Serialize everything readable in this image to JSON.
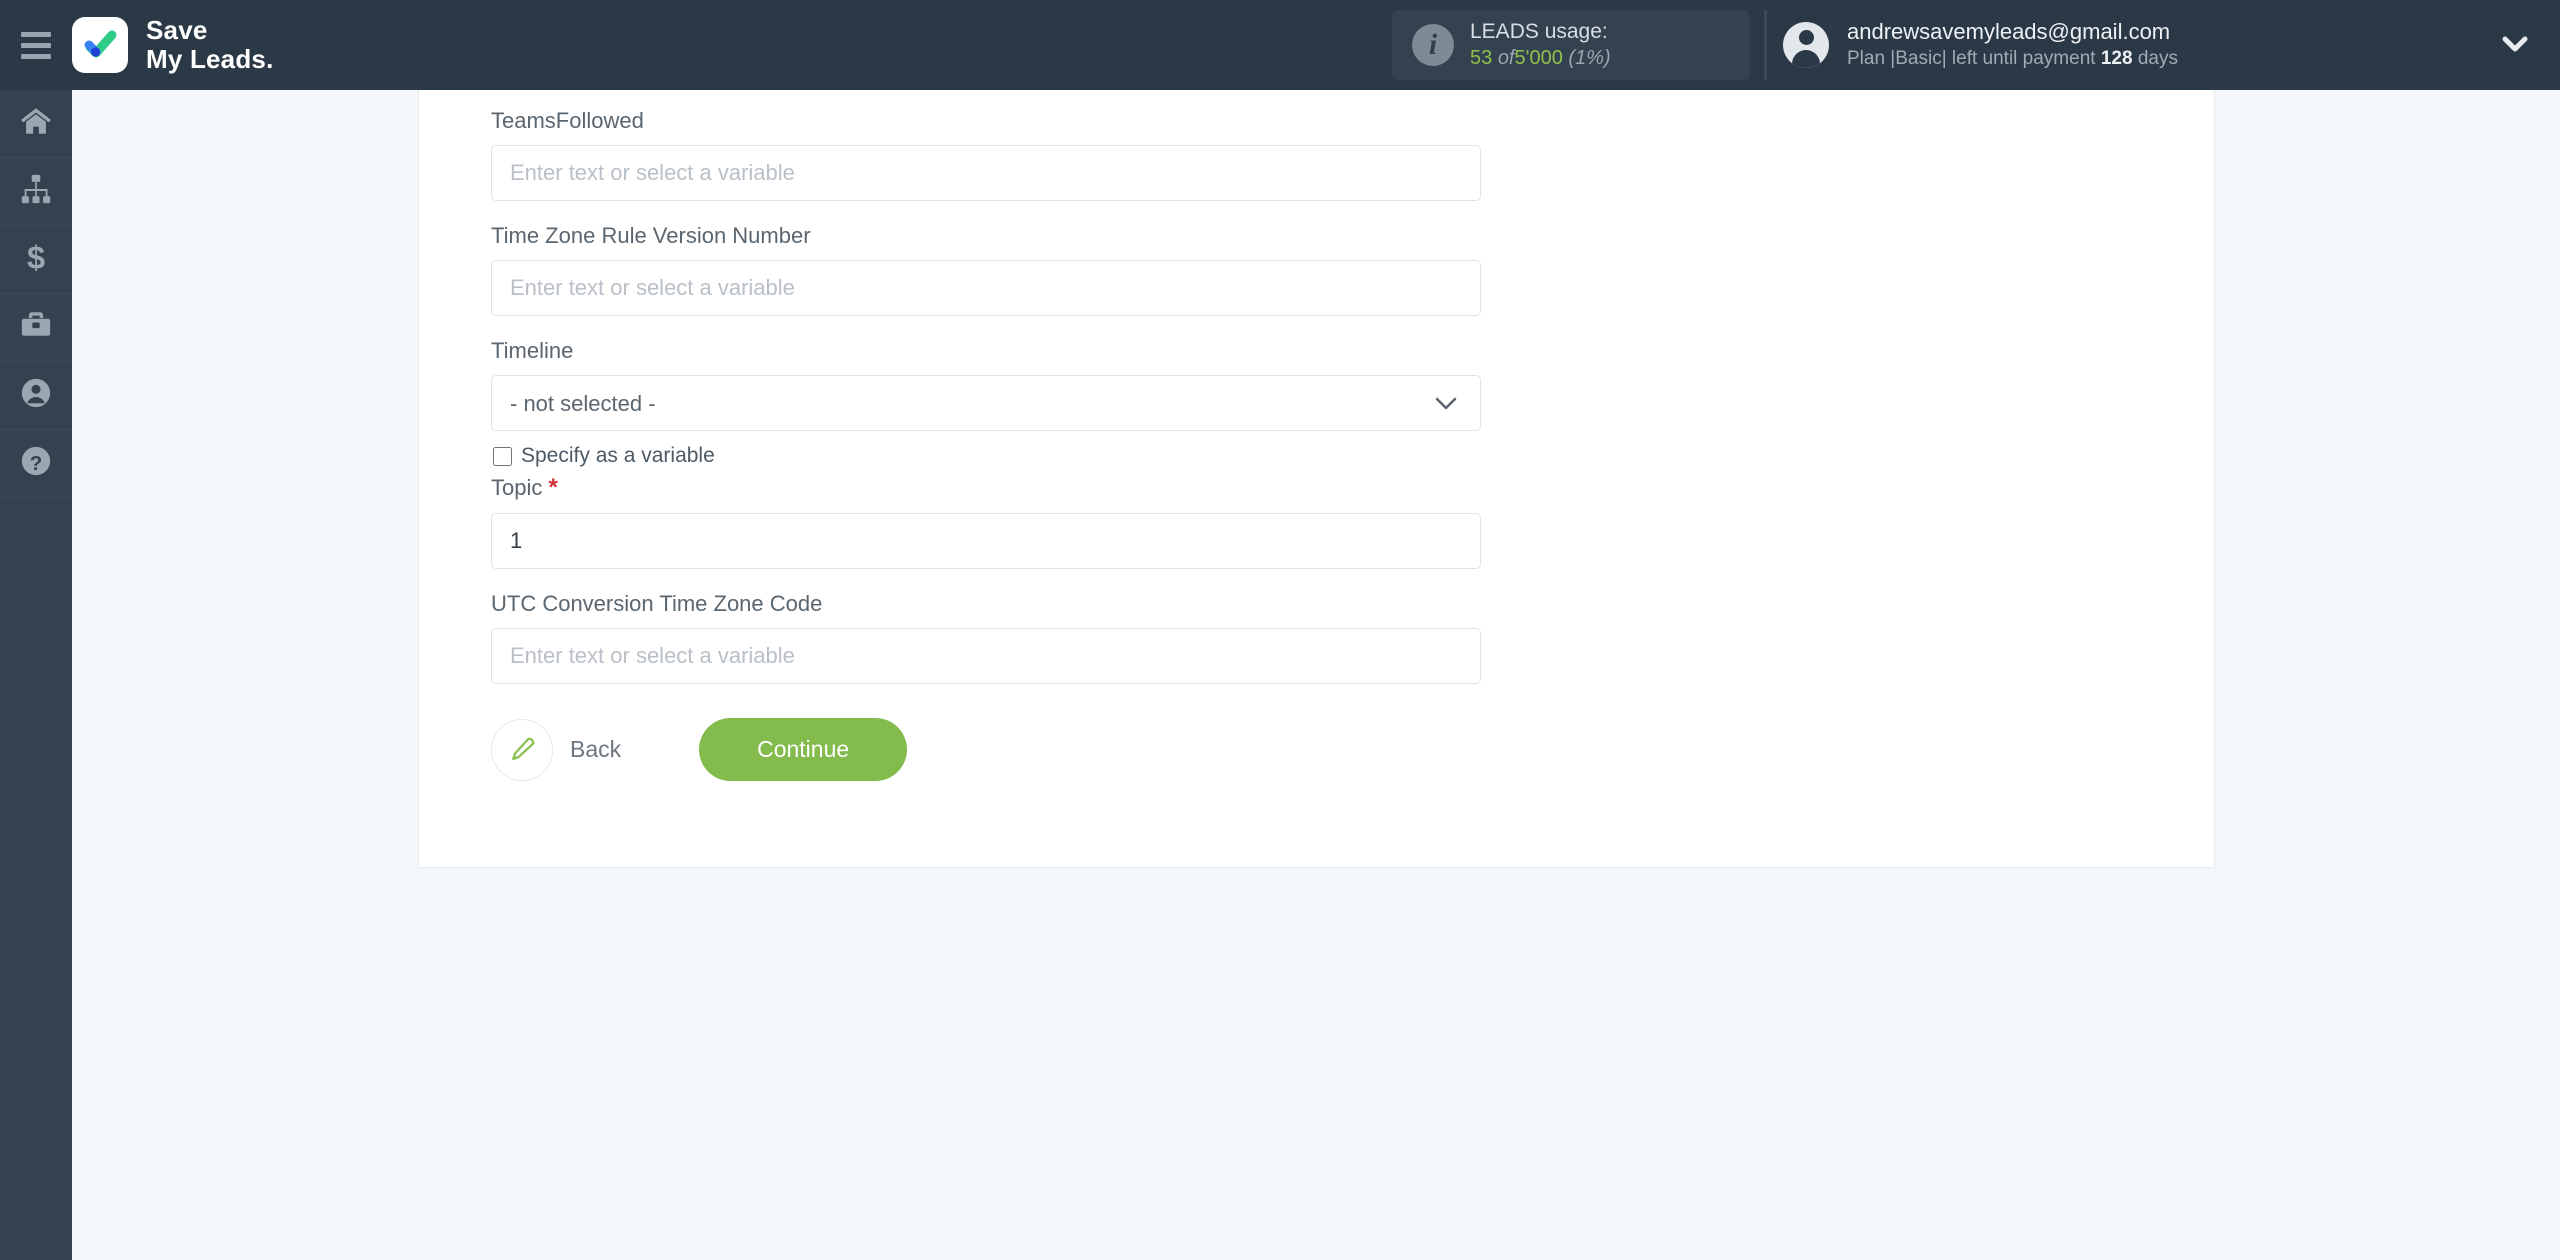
{
  "topbar": {
    "menu_icon": "hamburger-icon",
    "brand_line1": "Save",
    "brand_line2": "My Leads.",
    "usage": {
      "icon": "info-icon",
      "title": "LEADS usage:",
      "used": "53",
      "of": "of",
      "limit": "5'000",
      "percent": "(1%)",
      "accent_color": "#8fc04e"
    },
    "account": {
      "avatar_icon": "user-avatar-icon",
      "email": "andrewsavemyleads@gmail.com",
      "plan_prefix": "Plan |Basic| left until payment",
      "days_value": "128",
      "days_suffix": "days",
      "caret_icon": "chevron-down-icon"
    }
  },
  "sidebar": {
    "items": [
      {
        "name": "home",
        "icon": "home-icon"
      },
      {
        "name": "connections",
        "icon": "sitemap-icon"
      },
      {
        "name": "billing",
        "icon": "dollar-icon"
      },
      {
        "name": "services",
        "icon": "briefcase-icon"
      },
      {
        "name": "profile",
        "icon": "user-circle-icon"
      },
      {
        "name": "help",
        "icon": "question-circle-icon"
      }
    ]
  },
  "form": {
    "fields": [
      {
        "label": "TeamsFollowed",
        "type": "text",
        "value": "",
        "placeholder": "Enter text or select a variable",
        "required": false
      },
      {
        "label": "Time Zone Rule Version Number",
        "type": "text",
        "value": "",
        "placeholder": "Enter text or select a variable",
        "required": false
      },
      {
        "label": "Timeline",
        "type": "select",
        "value": "- not selected -",
        "options": [
          "- not selected -"
        ],
        "required": false,
        "checkbox_label": "Specify as a variable",
        "checkbox_checked": false
      },
      {
        "label": "Topic",
        "type": "text",
        "value": "1",
        "placeholder": "",
        "required": true,
        "required_mark": "*"
      },
      {
        "label": "UTC Conversion Time Zone Code",
        "type": "text",
        "value": "",
        "placeholder": "Enter text or select a variable",
        "required": false
      }
    ],
    "actions": {
      "back_label": "Back",
      "back_icon": "pencil-icon",
      "continue_label": "Continue",
      "continue_color": "#83bb4d"
    }
  }
}
